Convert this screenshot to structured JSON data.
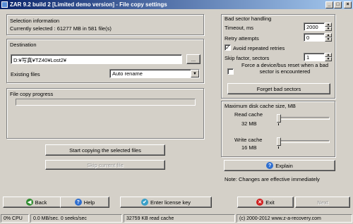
{
  "window": {
    "title": "ZAR 9.2 build 2 [Limited demo version] - File copy settings",
    "min": "_",
    "max": "□",
    "close": "×"
  },
  "selection": {
    "heading": "Selection information",
    "summary": "Currently selected : 61277 MB in 581 file(s)"
  },
  "destination": {
    "heading": "Destination",
    "path": "D:¥写真¥TZ40¥Lost2¥",
    "browse_label": "...",
    "existing_label": "Existing files",
    "existing_value": "Auto rename"
  },
  "progress": {
    "heading": "File copy progress",
    "value_fraction": 0
  },
  "actions": {
    "start_label": "Start copying the selected files",
    "skip_label": "Skip current file"
  },
  "bad_sector": {
    "heading": "Bad sector handling",
    "timeout_label": "Timeout, ms",
    "timeout_value": "2000",
    "retry_label": "Retry attempts",
    "retry_value": "0",
    "avoid_label": "Avoid repeated retries",
    "avoid_checked": "✓",
    "skip_label": "Skip factor, sectors",
    "skip_value": "1",
    "force_label": "Force a device/bus reset when a bad sector is encountered",
    "force_checked": "",
    "forget_label": "Forget bad sectors"
  },
  "cache": {
    "heading": "Maximum disk cache size, MB",
    "read_label": "Read cache",
    "read_value": "32 MB",
    "write_label": "Write cache",
    "write_value": "16 MB",
    "explain_label": "Explain"
  },
  "note": "Note: Changes are effective immediately",
  "bottom": {
    "back_label": "Back",
    "help_label": "Help",
    "license_label": "Enter license key",
    "exit_label": "Exit",
    "next_label": "Next"
  },
  "statusbar": {
    "cpu": "0% CPU",
    "io": "0.0 MB/sec. 0 seeks/sec",
    "cache": "32759 KB read cache",
    "copyright": "(c) 2000-2012 www.z-a-recovery.com"
  },
  "colors": {
    "titlebar_start": "#0a246a",
    "titlebar_end": "#a6caf0",
    "back_icon": "#2e8b2e",
    "help_icon": "#2f6fd0",
    "license_icon": "#3aa0c8",
    "exit_icon": "#d02020",
    "explain_icon": "#2f6fd0"
  }
}
